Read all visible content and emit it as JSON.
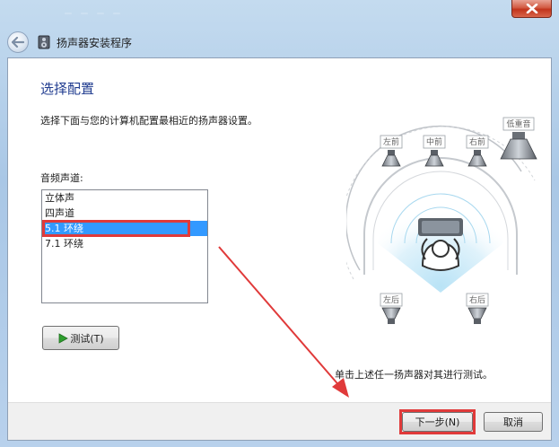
{
  "window": {
    "title": "扬声器安装程序",
    "background_tabs": [
      "  ",
      "  ",
      "  ",
      "  "
    ]
  },
  "main": {
    "heading": "选择配置",
    "description": "选择下面与您的计算机配置最相近的扬声器设置。",
    "channel_label": "音频声道:",
    "channels": [
      "立体声",
      "四声道",
      "5.1 环绕",
      "7.1 环绕"
    ],
    "selected_channel": "5.1 环绕",
    "test_button": "测试(T)",
    "hint": "单击上述任一扬声器对其进行测试。"
  },
  "diagram": {
    "speakers": {
      "front_left": "左前",
      "center": "中前",
      "front_right": "右前",
      "subwoofer": "低重音",
      "rear_left": "左后",
      "rear_right": "右后"
    }
  },
  "footer": {
    "next_button": "下一步(N)",
    "cancel_button": "取消"
  },
  "colors": {
    "heading": "#1f3b8f",
    "selection": "#3399ff",
    "highlight_box": "#e03a3a",
    "arrow": "#e03a3a",
    "test_icon": "#2e9e2e"
  },
  "icons": [
    "back-arrow-icon",
    "speaker-app-icon",
    "close-icon",
    "play-icon",
    "speaker-icon",
    "listener-icon"
  ]
}
